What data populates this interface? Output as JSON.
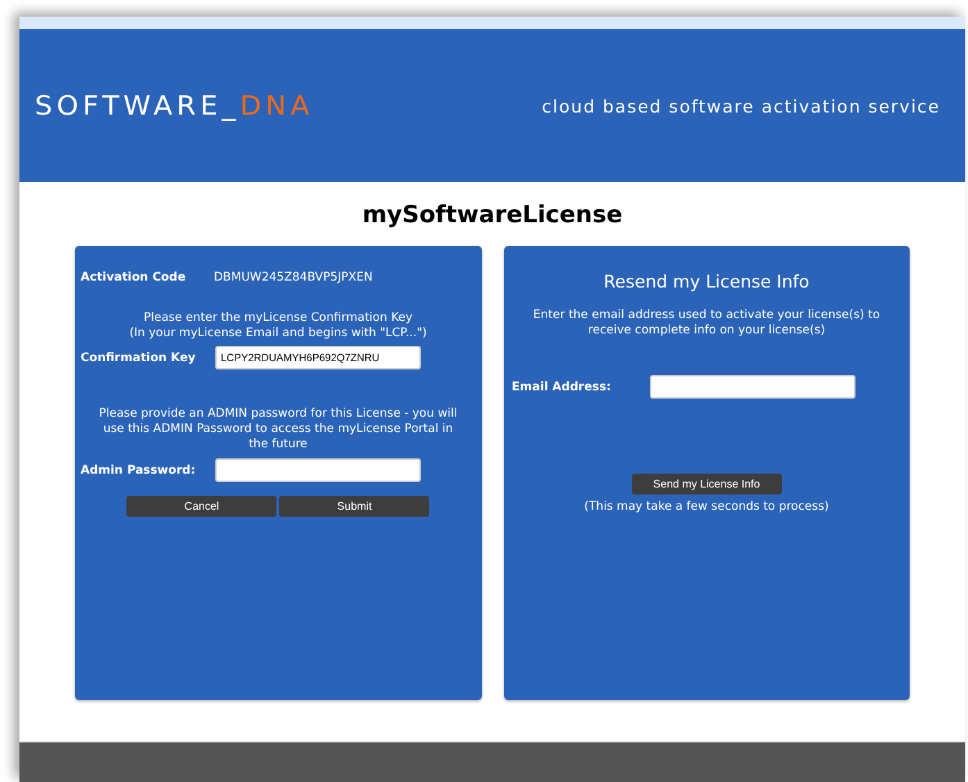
{
  "header": {
    "logo_main": "SOFTWARE_",
    "logo_accent": "DNA",
    "tagline": "cloud based software activation service"
  },
  "title": "mySoftwareLicense",
  "activation": {
    "code_label": "Activation Code",
    "code": "DBMUW245Z84BVP5JPXEN",
    "key_instructions": [
      "Please enter the myLicense Confirmation Key",
      "(In your myLicense Email and begins with \"LCP...\")"
    ],
    "key_label": "Confirmation Key",
    "key_value": "LCPY2RDUAMYH6P692Q7ZNRU",
    "password_instructions": "Please provide an ADMIN password for this License - you will use this ADMIN Password to access the myLicense Portal in the future",
    "password_label": "Admin Password:",
    "buttons": [
      "Cancel",
      "Submit"
    ]
  },
  "resend": {
    "title": "Resend my License Info",
    "instructions": "Enter the email address used to activate your license(s) to receive complete info on your license(s)",
    "email_label": "Email Address:",
    "button": "Send my License Info",
    "note": "(This may take a few seconds to process)"
  }
}
